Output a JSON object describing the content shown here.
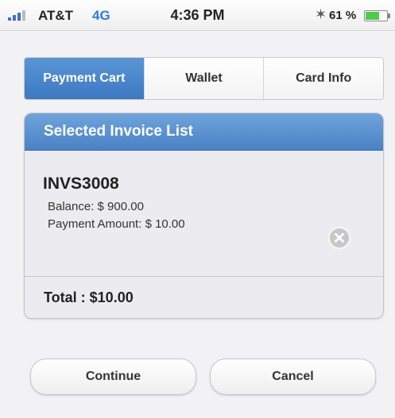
{
  "status_bar": {
    "carrier": "AT&T",
    "network": "4G",
    "time": "4:36 PM",
    "battery": "61 %",
    "icons": [
      "signal-bars",
      "bluetooth",
      "battery"
    ]
  },
  "tabs": [
    {
      "label": "Payment Cart",
      "active": true
    },
    {
      "label": "Wallet",
      "active": false
    },
    {
      "label": "Card Info",
      "active": false
    }
  ],
  "invoice_panel": {
    "header": "Selected Invoice List",
    "invoice": {
      "id": "INVS3008",
      "balance": "Balance:  $ 900.00",
      "payment_amount": "Payment Amount:  $ 10.00"
    },
    "total": "Total : $10.00"
  },
  "buttons": {
    "continue": "Continue",
    "cancel": "Cancel"
  },
  "colors": {
    "accent": "#4a82c5",
    "network": "#2a7de1"
  }
}
